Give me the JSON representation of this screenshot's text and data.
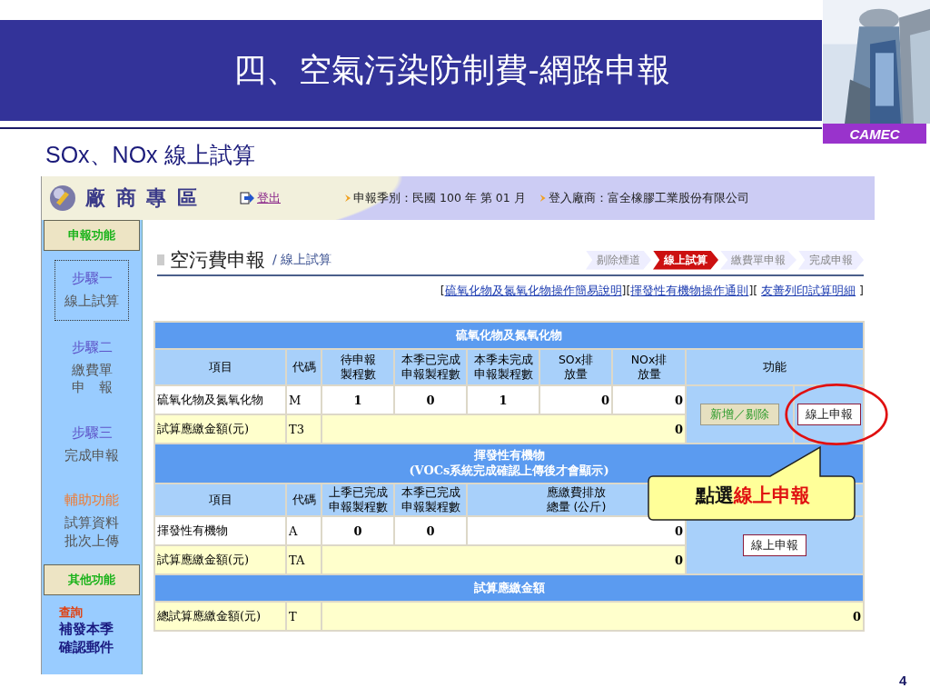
{
  "slide": {
    "title": "四、空氣污染防制費-網路申報",
    "subtitle": "SOx、NOx 線上試算",
    "logo_label": "CAMEC",
    "page_number": "4"
  },
  "header": {
    "brand": "廠 商 專 區",
    "logout": "登出",
    "period": "申報季別：民國 100 年 第 01 月",
    "company": "登入廠商：富全橡膠工業股份有限公司"
  },
  "sidebar": [
    {
      "kind": "heading",
      "label": "申報功能"
    },
    {
      "kind": "step",
      "label": "步驟一",
      "action": "線上試算",
      "selected": true
    },
    {
      "kind": "step",
      "label": "步驟二",
      "action": "繳費單申　報",
      "selected": false
    },
    {
      "kind": "step",
      "label": "步驟三",
      "action": "完成申報",
      "selected": false
    },
    {
      "kind": "aux",
      "label": "輔助功能",
      "action": "試算資料批次上傳"
    },
    {
      "kind": "heading",
      "label": "其他功能"
    },
    {
      "kind": "query",
      "label": "查詢",
      "action": "補發本季確認郵件"
    }
  ],
  "page_title": {
    "main": "空污費申報",
    "sub": "/ 線上試算"
  },
  "progress_steps": [
    {
      "label": "剔除煙道",
      "selected": false
    },
    {
      "label": "線上試算",
      "selected": true
    },
    {
      "label": "繳費單申報",
      "selected": false
    },
    {
      "label": "完成申報",
      "selected": false
    }
  ],
  "help_links": [
    {
      "open": "[",
      "label": "硫氧化物及氮氧化物操作簡易說明",
      "close": "]"
    },
    {
      "open": "[",
      "label": "揮發性有機物操作通則",
      "close": "]"
    },
    {
      "open": "[ ",
      "label": "友善列印試算明細",
      "close": " ]"
    }
  ],
  "sections": [
    {
      "title": [
        "硫氧化物及氮氧化物"
      ],
      "columns": [
        "項目",
        "代碼",
        "待申報製程數",
        "本季已完成申報製程數",
        "本季未完成申報製程數",
        "SOx排放量",
        "NOx排放量",
        "功能"
      ],
      "row": [
        "硫氧化物及氮氧化物",
        "M",
        "1",
        "0",
        "1",
        "0",
        "0"
      ],
      "total": [
        "試算應繳金額(元)",
        "T3",
        "0"
      ],
      "actions": [
        "新增／剔除",
        "線上申報"
      ]
    },
    {
      "title": [
        "揮發性有機物",
        "(VOCs系統完成確認上傳後才會顯示)"
      ],
      "columns": [
        "項目",
        "代碼",
        "上季已完成申報製程數",
        "本季已完成申報製程數",
        "應繳費排放總量 (公斤)"
      ],
      "row": [
        "揮發性有機物",
        "A",
        "0",
        "0",
        "0"
      ],
      "total": [
        "試算應繳金額(元)",
        "TA",
        "0"
      ],
      "actions": [
        "線上申報"
      ]
    },
    {
      "title": [
        "試算應繳金額"
      ],
      "total": [
        "總試算應繳金額(元)",
        "T",
        "0"
      ]
    }
  ],
  "callout": {
    "text": "點選",
    "highlight": "線上申報"
  }
}
